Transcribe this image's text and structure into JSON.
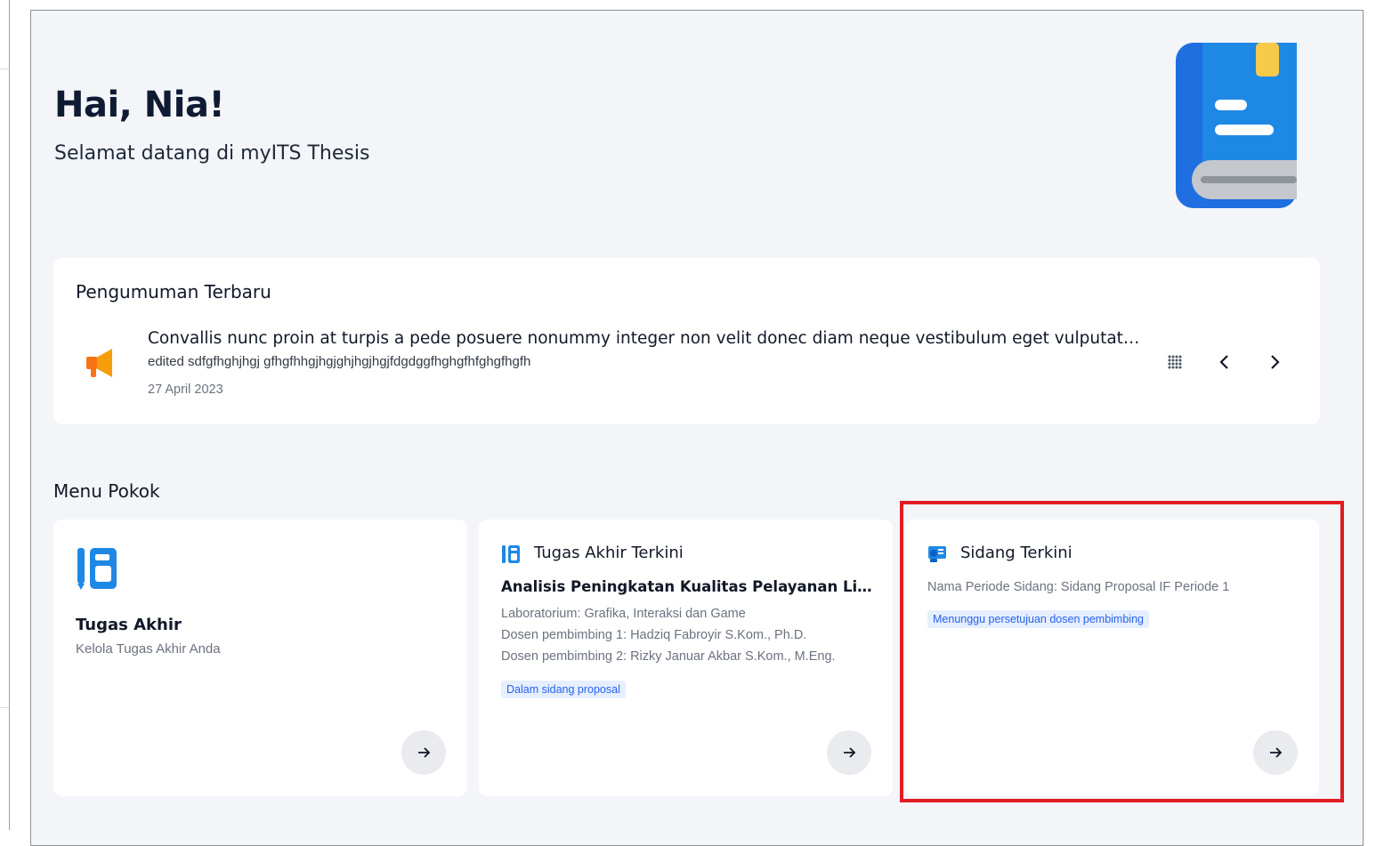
{
  "greeting": {
    "title": "Hai, Nia!",
    "subtitle": "Selamat datang di myITS Thesis"
  },
  "announcement": {
    "section_title": "Pengumuman Terbaru",
    "headline": "Convallis nunc proin at turpis a pede posuere nonummy integer non velit donec diam neque vestibulum eget vulputat…",
    "description": "edited sdfgfhghjhgj gfhgfhhgjhgjghjhgjhgjfdgdggfhghgfhfghgfhgfh",
    "date": "27 April 2023",
    "icons": {
      "announcement": "megaphone-icon",
      "grid": "grid-icon",
      "prev": "chevron-left-icon",
      "next": "chevron-right-icon"
    }
  },
  "menu": {
    "section_title": "Menu Pokok",
    "cards": [
      {
        "title": "Tugas Akhir",
        "subtitle": "Kelola Tugas Akhir Anda",
        "icon": "thesis-book-icon"
      },
      {
        "title": "Tugas Akhir Terkini",
        "thesis_title": "Analisis Peningkatan Kualitas Pelayanan Listri…",
        "lab": "Laboratorium: Grafika, Interaksi dan Game",
        "advisor1": "Dosen pembimbing 1: Hadziq Fabroyir S.Kom., Ph.D.",
        "advisor2": "Dosen pembimbing 2: Rizky Januar Akbar S.Kom., M.Eng.",
        "status": "Dalam sidang proposal",
        "icon": "thesis-book-icon"
      },
      {
        "title": "Sidang Terkini",
        "period": "Nama Periode Sidang: Sidang Proposal IF Periode 1",
        "status": "Menunggu persetujuan dosen pembimbing",
        "icon": "presentation-icon"
      }
    ]
  },
  "colors": {
    "accent_blue": "#1e88e5",
    "badge_text": "#2563eb",
    "badge_bg": "#e6efff",
    "highlight_red": "#e31b23",
    "page_bg": "#f3f5f9"
  }
}
